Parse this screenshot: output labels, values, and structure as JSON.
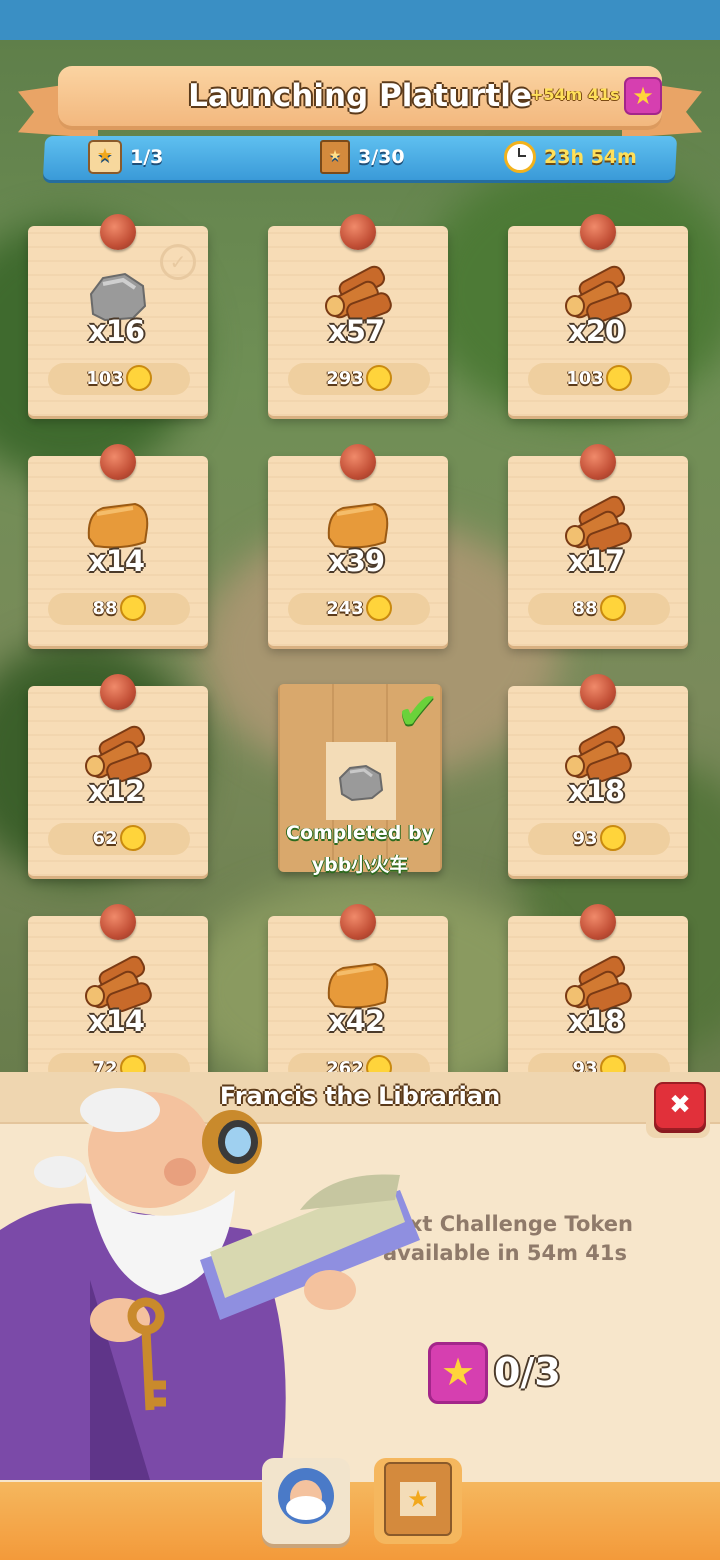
{
  "header": {
    "title": "Launching Platurtle",
    "bonus_time": "+54m 41s",
    "stats": {
      "days": "1/3",
      "cards": "3/30",
      "timer": "23h 54m"
    }
  },
  "cards": [
    {
      "item": "stone",
      "qty": "x16",
      "price": "103",
      "done": true
    },
    {
      "item": "wood",
      "qty": "x57",
      "price": "293"
    },
    {
      "item": "wood",
      "qty": "x20",
      "price": "103"
    },
    {
      "item": "clay",
      "qty": "x14",
      "price": "88"
    },
    {
      "item": "clay",
      "qty": "x39",
      "price": "243"
    },
    {
      "item": "wood",
      "qty": "x17",
      "price": "88"
    },
    {
      "item": "wood",
      "qty": "x12",
      "price": "62"
    },
    {
      "item": "wood",
      "qty": "x18",
      "price": "93"
    },
    {
      "item": "wood",
      "qty": "x14",
      "price": "72"
    },
    {
      "item": "clay",
      "qty": "x42",
      "price": "262"
    },
    {
      "item": "wood",
      "qty": "x18",
      "price": "93"
    }
  ],
  "completed": {
    "label": "Completed by",
    "user": "ybb小火车"
  },
  "panel": {
    "title": "Francis the Librarian",
    "close_label": "✖",
    "token_line1": "Next Challenge Token",
    "token_line2": "available in 54m 41s",
    "token_count": "0/3"
  },
  "colors": {
    "accent_pink": "#d63fb0",
    "star_gold": "#ffd43b",
    "bar_blue": "#3a9ad8",
    "paper": "#f7dcb6"
  }
}
